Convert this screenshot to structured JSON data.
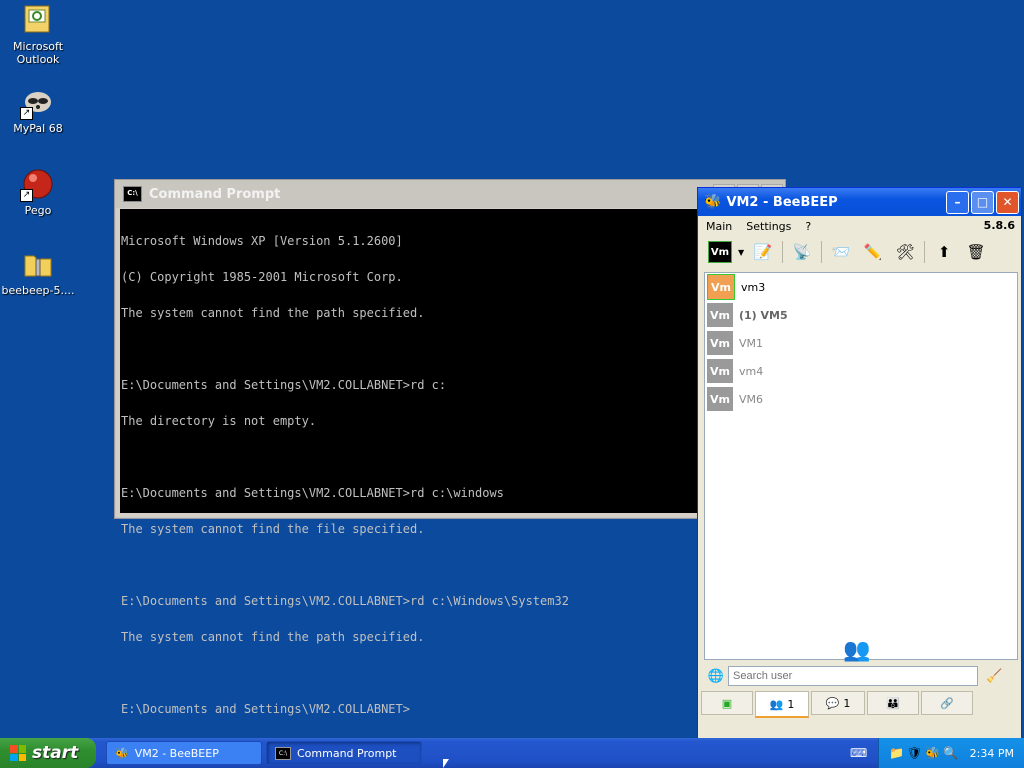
{
  "desktop": {
    "icons": [
      {
        "label": "Microsoft Outlook",
        "icon": "outlook-icon"
      },
      {
        "label": "MyPal 68",
        "icon": "raccoon-icon"
      },
      {
        "label": "Pego",
        "icon": "red-ball-icon"
      },
      {
        "label": "beebeep-5....",
        "icon": "zip-folder-icon"
      }
    ]
  },
  "cmd": {
    "title": "Command Prompt",
    "icon_text": "C:\\",
    "lines": [
      "Microsoft Windows XP [Version 5.1.2600]",
      "(C) Copyright 1985-2001 Microsoft Corp.",
      "The system cannot find the path specified.",
      "",
      "E:\\Documents and Settings\\VM2.COLLABNET>rd c:",
      "The directory is not empty.",
      "",
      "E:\\Documents and Settings\\VM2.COLLABNET>rd c:\\windows",
      "The system cannot find the file specified.",
      "",
      "E:\\Documents and Settings\\VM2.COLLABNET>rd c:\\Windows\\System32",
      "The system cannot find the path specified.",
      "",
      "E:\\Documents and Settings\\VM2.COLLABNET>"
    ]
  },
  "beebeep": {
    "title": "VM2 - BeeBEEP",
    "menu": {
      "main": "Main",
      "settings": "Settings",
      "help": "?"
    },
    "version": "5.8.6",
    "toolbar_vm": "Vm",
    "users": [
      {
        "avatar": "Vm",
        "name": "vm3",
        "status": "online"
      },
      {
        "avatar": "Vm",
        "name": "(1) VM5",
        "status": "unread"
      },
      {
        "avatar": "Vm",
        "name": "VM1",
        "status": "offline"
      },
      {
        "avatar": "Vm",
        "name": "vm4",
        "status": "offline"
      },
      {
        "avatar": "Vm",
        "name": "VM6",
        "status": "offline"
      }
    ],
    "search_placeholder": "Search user",
    "tabs": [
      {
        "icon": "chat-icon",
        "count": ""
      },
      {
        "icon": "users-icon",
        "count": "1"
      },
      {
        "icon": "chats-icon",
        "count": "1"
      },
      {
        "icon": "groups-icon",
        "count": ""
      },
      {
        "icon": "shares-icon",
        "count": ""
      }
    ]
  },
  "taskbar": {
    "start_label": "start",
    "buttons": [
      {
        "label": "VM2 - BeeBEEP",
        "active": false
      },
      {
        "label": "Command Prompt",
        "active": true
      }
    ],
    "clock": "2:34 PM"
  }
}
